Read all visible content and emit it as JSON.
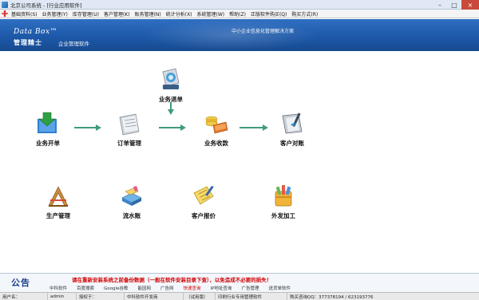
{
  "window": {
    "title": "北京公司系统 - [行业应用软件]",
    "controls": [
      "–",
      "□",
      "×"
    ]
  },
  "menu": [
    "基础资料(S)",
    "业务管理(Y)",
    "库存管理(U)",
    "客户管理(K)",
    "账务管理(N)",
    "统计分析(X)",
    "系统管理(W)",
    "帮助(Z)",
    "正版软件购买(Q)",
    "购买方式(R)"
  ],
  "banner": {
    "brand_en": "Data Box™",
    "brand_cn": "管理精士",
    "brand_sub": "企业管理软件",
    "slogan": "中小企业信息化管理解决方案"
  },
  "modules": {
    "order_start": "业务开单",
    "order_mgmt": "订单管理",
    "order_return": "业务退单",
    "payment": "业务收款",
    "reconcile": "客户对账",
    "production": "生产管理",
    "ledger": "流水账",
    "quote": "客户报价",
    "outsource": "外发加工"
  },
  "notice": {
    "title": "公告",
    "warning": "请在重新安装系统之前备份数据（一般在软件安装目录下查），以免造成不必要的损失！",
    "links": [
      "中科软件",
      "百度搜索",
      "Google谷歌",
      "能因网",
      "广告网",
      "快速查询",
      "IP地址查询",
      "广告管理",
      "送货单软件"
    ]
  },
  "status": {
    "user_label": "用户名：",
    "user": "admin",
    "license_label": "授权于：",
    "vendor": "中科软件开发商",
    "edition": "（试用版）",
    "org": "印刷行业专用管理软件",
    "contact": "购买咨询QQ：377378194 / 623193776"
  },
  "colors": {
    "banner": "#1c57a6",
    "arrow": "#3f9a7c",
    "warning": "#d20000",
    "notice_title": "#1a3f8f"
  }
}
